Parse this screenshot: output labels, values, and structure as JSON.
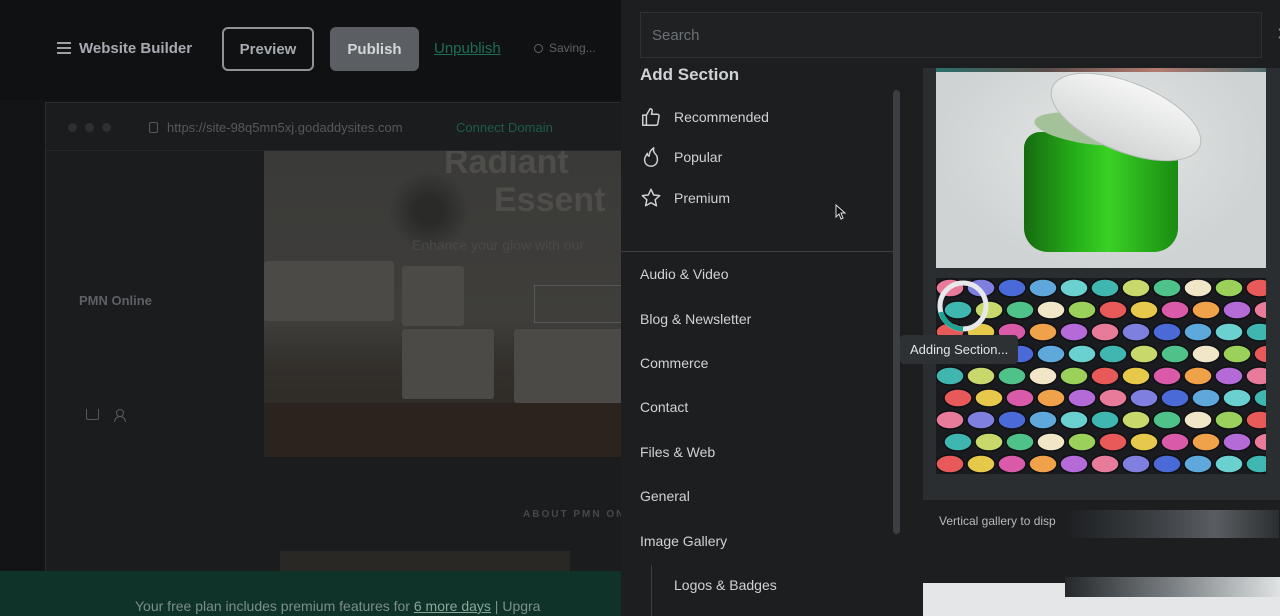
{
  "builder": {
    "title": "Website Builder",
    "preview_label": "Preview",
    "publish_label": "Publish",
    "unpublish_label": "Unpublish",
    "saving_label": "Saving...",
    "url": "https://site-98q5mn5xj.godaddysites.com",
    "connect_domain_label": "Connect Domain",
    "site_name": "PMN Online",
    "hero": {
      "title_line1": "Radiant",
      "title_line2": "Essent",
      "subtitle": "Enhance your glow with our"
    },
    "about_label": "ABOUT PMN ON",
    "plan_bar": {
      "text_prefix": "Your free plan includes premium features for ",
      "days_link": "6 more days",
      "separator": " | ",
      "upgrade": "Upgra"
    }
  },
  "panel": {
    "search_placeholder": "Search",
    "close_icon": "close-icon",
    "title": "Add Section",
    "quick_filters": [
      {
        "label": "Recommended",
        "icon": "thumbs-up-icon"
      },
      {
        "label": "Popular",
        "icon": "flame-icon"
      },
      {
        "label": "Premium",
        "icon": "star-icon"
      }
    ],
    "categories": [
      "Audio & Video",
      "Blog & Newsletter",
      "Commerce",
      "Contact",
      "Files & Web",
      "General",
      "Image Gallery"
    ],
    "subcategories": [
      "Logos & Badges"
    ],
    "preview_caption": "Vertical gallery to disp",
    "loading_tooltip": "Adding Section..."
  },
  "colors": {
    "accent_green": "#1f6e55",
    "spinner": "#1aa393",
    "jar_green": "#27b21a"
  }
}
